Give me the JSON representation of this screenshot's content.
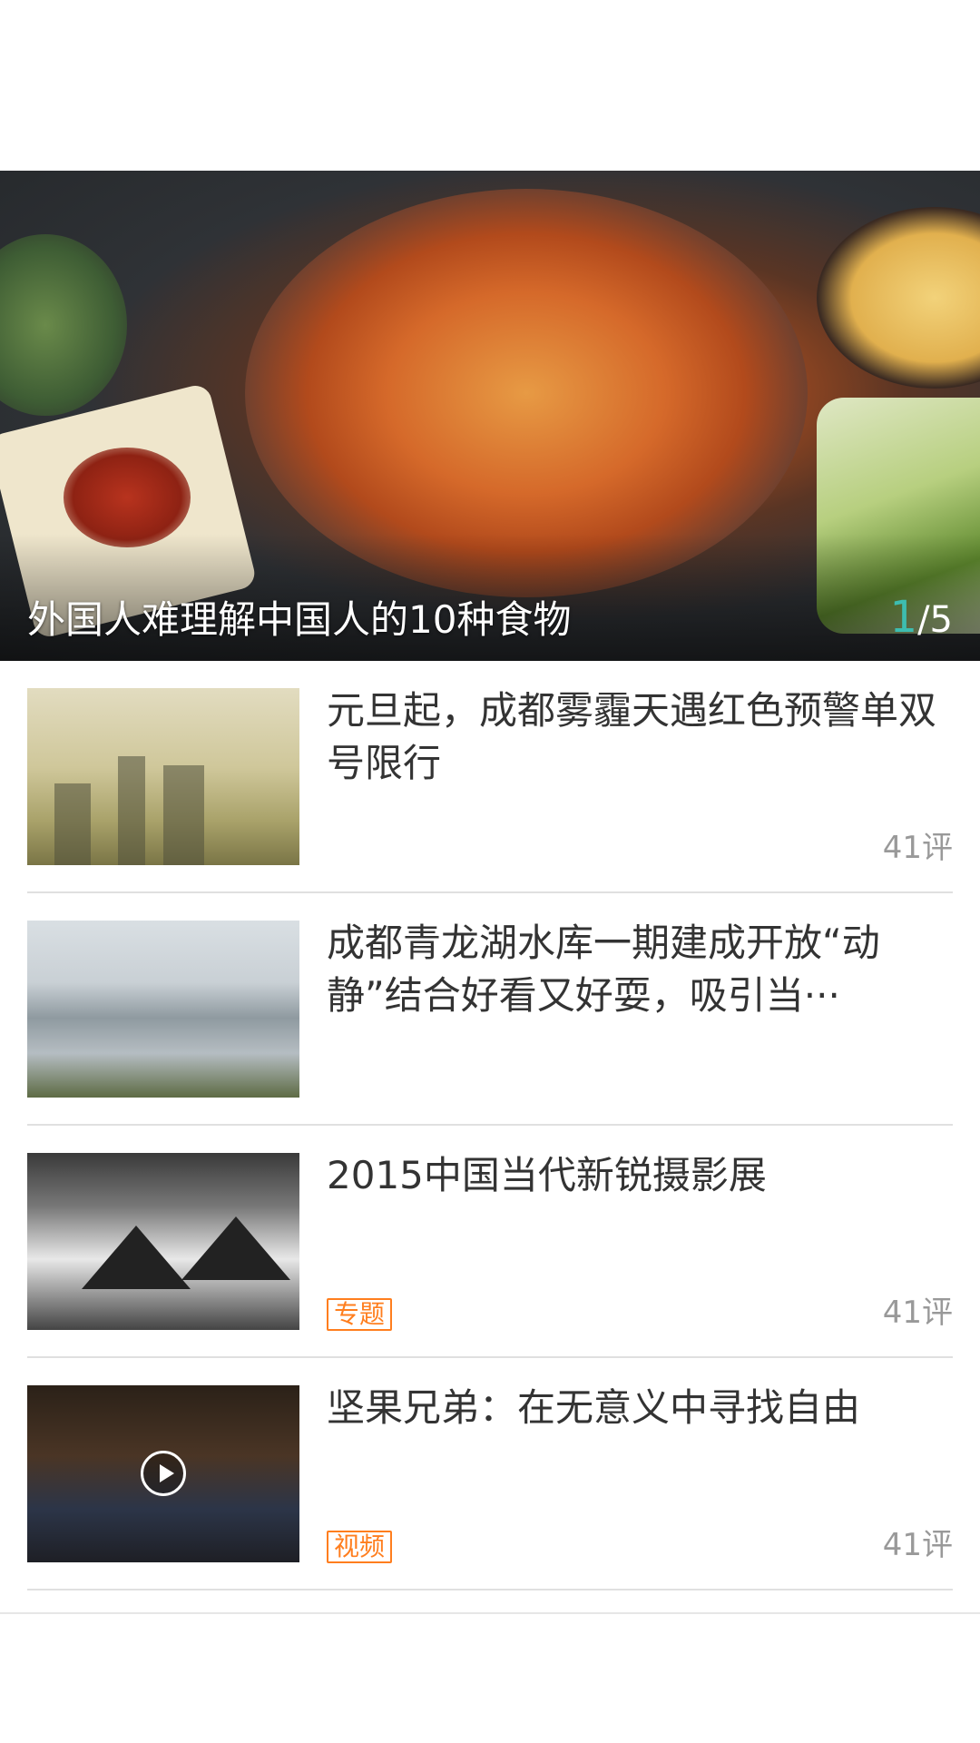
{
  "banner": {
    "title": "外国人难理解中国人的10种食物",
    "pager_current": "1",
    "pager_total": "/5",
    "accent_color": "#3dbdb0"
  },
  "news": [
    {
      "title": "元旦起，成都雾霾天遇红色预警单双号限行",
      "comments": "41评",
      "tag": "",
      "thumb": "smog-city-photo"
    },
    {
      "title": "成都青龙湖水库一期建成开放“动静”结合好看又好耍，吸引当···",
      "comments": "",
      "tag": "",
      "thumb": "lake-reservoir-photo"
    },
    {
      "title": "2015中国当代新锐摄影展",
      "comments": "41评",
      "tag": "专题",
      "thumb": "ink-mountain-photo"
    },
    {
      "title": "坚果兄弟：在无意义中寻找自由",
      "comments": "41评",
      "tag": "视频",
      "thumb": "video-person-photo"
    }
  ],
  "colors": {
    "tag": "#ff7e1e",
    "title_text": "#333333",
    "meta_text": "#999999",
    "divider": "#e0e0e0"
  }
}
